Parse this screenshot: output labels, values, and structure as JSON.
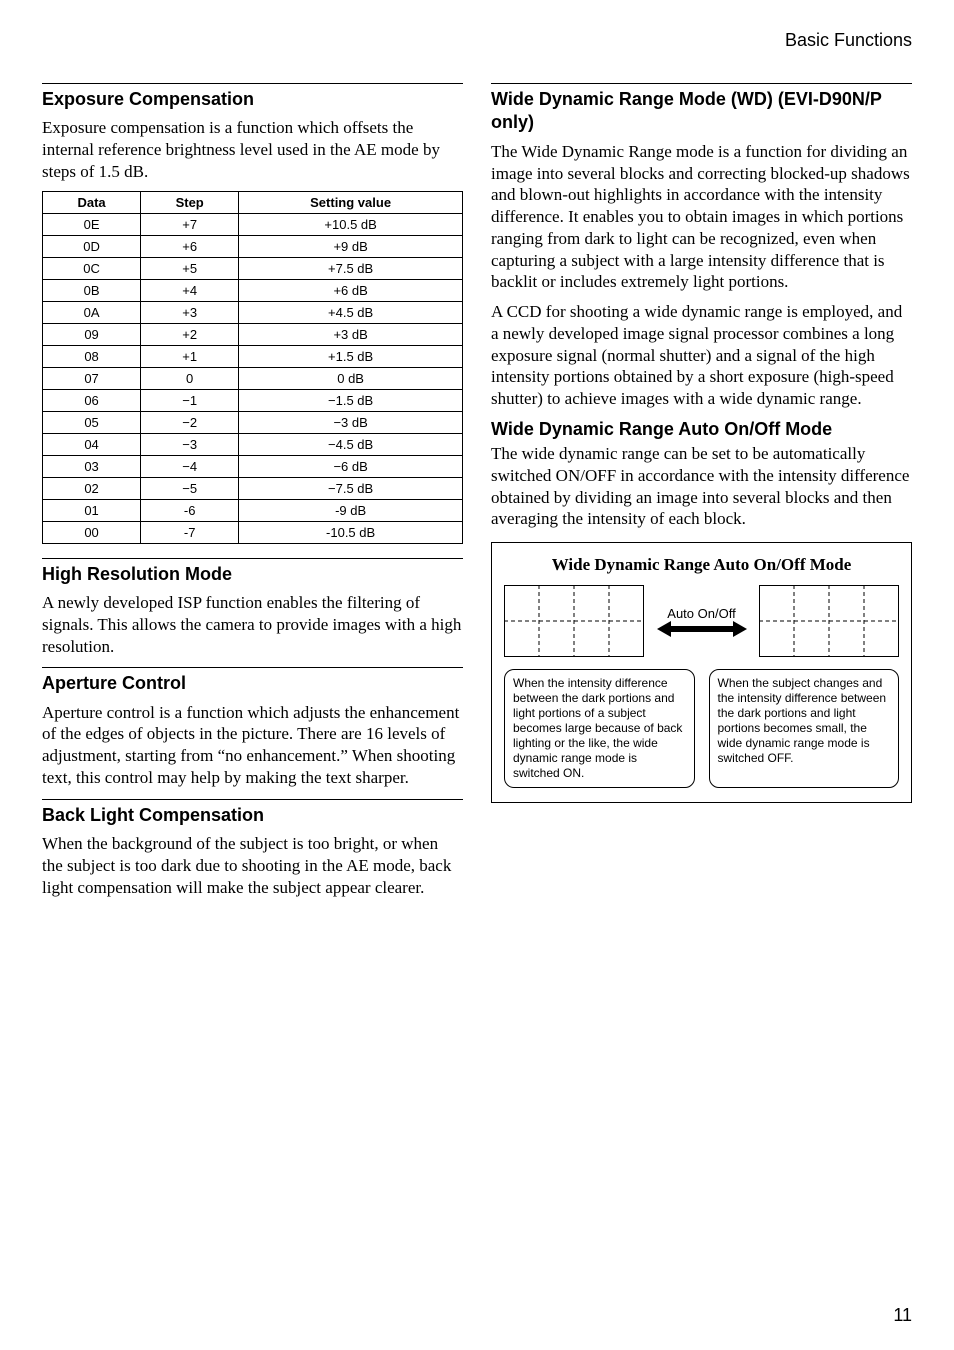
{
  "running_head": "Basic Functions",
  "page_number": "11",
  "left": {
    "exposure": {
      "heading": "Exposure Compensation",
      "body": "Exposure compensation is a function which offsets the internal reference brightness level used in the AE mode by steps of 1.5 dB.",
      "table": {
        "headers": [
          "Data",
          "Step",
          "Setting value"
        ],
        "rows": [
          [
            "0E",
            "+7",
            "+10.5 dB"
          ],
          [
            "0D",
            "+6",
            "+9 dB"
          ],
          [
            "0C",
            "+5",
            "+7.5 dB"
          ],
          [
            "0B",
            "+4",
            "+6 dB"
          ],
          [
            "0A",
            "+3",
            "+4.5 dB"
          ],
          [
            "09",
            "+2",
            "+3 dB"
          ],
          [
            "08",
            "+1",
            "+1.5 dB"
          ],
          [
            "07",
            "0",
            "0 dB"
          ],
          [
            "06",
            "−1",
            "−1.5 dB"
          ],
          [
            "05",
            "−2",
            "−3 dB"
          ],
          [
            "04",
            "−3",
            "−4.5 dB"
          ],
          [
            "03",
            "−4",
            "−6 dB"
          ],
          [
            "02",
            "−5",
            "−7.5 dB"
          ],
          [
            "01",
            "-6",
            "-9 dB"
          ],
          [
            "00",
            "-7",
            "-10.5 dB"
          ]
        ]
      }
    },
    "highres": {
      "heading": "High Resolution Mode",
      "body": "A newly developed ISP function enables the filtering of signals. This allows the camera to provide images with a high resolution."
    },
    "aperture": {
      "heading": "Aperture Control",
      "body": "Aperture control is a function which adjusts the enhancement of the edges of objects in the picture. There are 16 levels of adjustment, starting from “no enhancement.” When shooting text, this control may help by making the text sharper."
    },
    "backlight": {
      "heading": "Back Light Compensation",
      "body": "When the background of the subject is too bright, or when the subject is too dark due to shooting in the AE mode, back light compensation will make the subject appear clearer."
    }
  },
  "right": {
    "wd": {
      "heading": "Wide Dynamic Range Mode (WD) (EVI-D90N/P only)",
      "body1": "The Wide Dynamic Range mode is a function for dividing an image into several blocks and correcting blocked-up shadows and blown-out highlights in accordance with the intensity difference. It enables you to obtain images in which portions ranging from dark to light can be recognized, even when capturing a subject with a large intensity difference that is backlit or includes extremely light portions.",
      "body2": "A CCD for shooting a wide dynamic range is employed, and a newly developed image signal processor combines a long exposure signal (normal shutter) and a signal of the high intensity portions obtained by a short exposure (high-speed shutter) to achieve images with a wide dynamic range."
    },
    "wd_auto": {
      "heading": "Wide Dynamic Range Auto On/Off Mode",
      "body": "The wide dynamic range can be set to be automatically switched ON/OFF in accordance with the intensity difference obtained by dividing an image into several blocks and then averaging the intensity of each block."
    },
    "figure": {
      "title": "Wide Dynamic Range Auto On/Off Mode",
      "arrow_label": "Auto On/Off",
      "caption_left": "When the intensity difference between the dark portions and light portions of a subject becomes large because of back lighting or the like, the wide dynamic range mode is switched ON.",
      "caption_right": "When the subject changes and the intensity difference between the dark portions and light portions becomes small, the wide dynamic range mode is switched OFF."
    }
  },
  "chart_data": {
    "type": "table",
    "title": "Exposure Compensation",
    "columns": [
      "Data",
      "Step",
      "Setting value"
    ],
    "rows": [
      {
        "Data": "0E",
        "Step": "+7",
        "Setting value": "+10.5 dB"
      },
      {
        "Data": "0D",
        "Step": "+6",
        "Setting value": "+9 dB"
      },
      {
        "Data": "0C",
        "Step": "+5",
        "Setting value": "+7.5 dB"
      },
      {
        "Data": "0B",
        "Step": "+4",
        "Setting value": "+6 dB"
      },
      {
        "Data": "0A",
        "Step": "+3",
        "Setting value": "+4.5 dB"
      },
      {
        "Data": "09",
        "Step": "+2",
        "Setting value": "+3 dB"
      },
      {
        "Data": "08",
        "Step": "+1",
        "Setting value": "+1.5 dB"
      },
      {
        "Data": "07",
        "Step": "0",
        "Setting value": "0 dB"
      },
      {
        "Data": "06",
        "Step": "−1",
        "Setting value": "−1.5 dB"
      },
      {
        "Data": "05",
        "Step": "−2",
        "Setting value": "−3 dB"
      },
      {
        "Data": "04",
        "Step": "−3",
        "Setting value": "−4.5 dB"
      },
      {
        "Data": "03",
        "Step": "−4",
        "Setting value": "−6 dB"
      },
      {
        "Data": "02",
        "Step": "−5",
        "Setting value": "−7.5 dB"
      },
      {
        "Data": "01",
        "Step": "-6",
        "Setting value": "-9 dB"
      },
      {
        "Data": "00",
        "Step": "-7",
        "Setting value": "-10.5 dB"
      }
    ]
  }
}
